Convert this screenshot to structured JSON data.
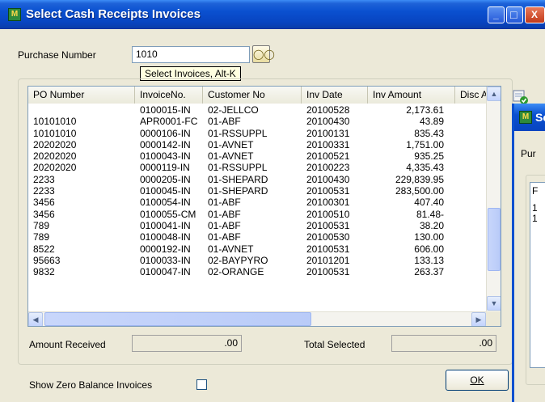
{
  "window": {
    "title": "Select Cash Receipts Invoices",
    "minimize_glyph": "_",
    "maximize_glyph": "□",
    "close_glyph": "X"
  },
  "purchase": {
    "label": "Purchase Number",
    "value": "1010",
    "lookup_icon": "binoculars-icon",
    "tooltip": "Select Invoices, Alt-K"
  },
  "grid": {
    "columns": [
      "PO Number",
      "InvoiceNo.",
      "Customer No",
      "Inv Date",
      "Inv Amount",
      "Disc A"
    ],
    "rows": [
      [
        "",
        "0100015-IN",
        "02-JELLCO",
        "20100528",
        "2,173.61"
      ],
      [
        "10101010",
        "APR0001-FC",
        "01-ABF",
        "20100430",
        "43.89"
      ],
      [
        "10101010",
        "0000106-IN",
        "01-RSSUPPL",
        "20100131",
        "835.43"
      ],
      [
        "20202020",
        "0000142-IN",
        "01-AVNET",
        "20100331",
        "1,751.00"
      ],
      [
        "20202020",
        "0100043-IN",
        "01-AVNET",
        "20100521",
        "935.25"
      ],
      [
        "20202020",
        "0000119-IN",
        "01-RSSUPPL",
        "20100223",
        "4,335.43"
      ],
      [
        "2233",
        "0000205-IN",
        "01-SHEPARD",
        "20100430",
        "229,839.95"
      ],
      [
        "2233",
        "0100045-IN",
        "01-SHEPARD",
        "20100531",
        "283,500.00"
      ],
      [
        "3456",
        "0100054-IN",
        "01-ABF",
        "20100301",
        "407.40"
      ],
      [
        "3456",
        "0100055-CM",
        "01-ABF",
        "20100510",
        "81.48-"
      ],
      [
        "789",
        "0100041-IN",
        "01-ABF",
        "20100531",
        "38.20"
      ],
      [
        "789",
        "0100048-IN",
        "01-ABF",
        "20100530",
        "130.00"
      ],
      [
        "8522",
        "0000192-IN",
        "01-AVNET",
        "20100531",
        "606.00"
      ],
      [
        "95663",
        "0100033-IN",
        "02-BAYPYRO",
        "20101201",
        "133.13"
      ],
      [
        "9832",
        "0100047-IN",
        "02-ORANGE",
        "20100531",
        "263.37"
      ]
    ]
  },
  "totals": {
    "amount_received_label": "Amount Received",
    "amount_received_value": ".00",
    "total_selected_label": "Total Selected",
    "total_selected_value": ".00"
  },
  "options": {
    "show_zero_label": "Show Zero Balance Invoices",
    "show_zero_checked": false
  },
  "buttons": {
    "ok_label": "OK",
    "side_icon": "select-check-icon"
  },
  "background_window": {
    "title_fragment": "Se",
    "label_fragment": "Pur",
    "header_fragment": "F",
    "row_fragments": [
      "1",
      "1"
    ]
  },
  "colors": {
    "titlebar": "#0a50d0",
    "dialog": "#ece9d8",
    "field_border": "#7f9db9"
  }
}
